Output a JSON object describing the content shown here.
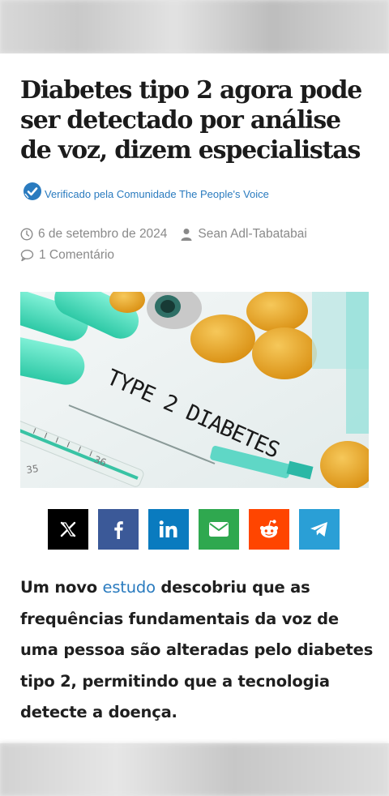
{
  "article": {
    "title": "Diabetes tipo 2 agora pode ser detectado por análise de voz, dizem especialistas",
    "verified_text": "Verificado pela Comunidade The People's Voice",
    "date": "6 de setembro de 2024",
    "author": "Sean Adl-Tabatabai",
    "comments": "1 Comentário",
    "hero_image_text": "TYPE 2 DIABETES",
    "lead_before": "Um novo ",
    "lead_link": "estudo",
    "lead_after": " descobriu que as frequências fundamentais da voz de uma pessoa são alteradas pelo diabetes tipo 2, permitindo que a tecnologia detecte a doença."
  },
  "share_buttons": [
    {
      "name": "x",
      "color": "#000000",
      "icon": "x-icon"
    },
    {
      "name": "facebook",
      "color": "#3b5998",
      "icon": "facebook-icon"
    },
    {
      "name": "linkedin",
      "color": "#0a7bbf",
      "icon": "linkedin-icon"
    },
    {
      "name": "email",
      "color": "#2fa84f",
      "icon": "envelope-icon"
    },
    {
      "name": "reddit",
      "color": "#ff4500",
      "icon": "reddit-icon"
    },
    {
      "name": "telegram",
      "color": "#2a9fd6",
      "icon": "telegram-icon"
    }
  ],
  "colors": {
    "link": "#2a7bbf",
    "meta": "#8a8a8a",
    "title": "#1b1b1b"
  }
}
